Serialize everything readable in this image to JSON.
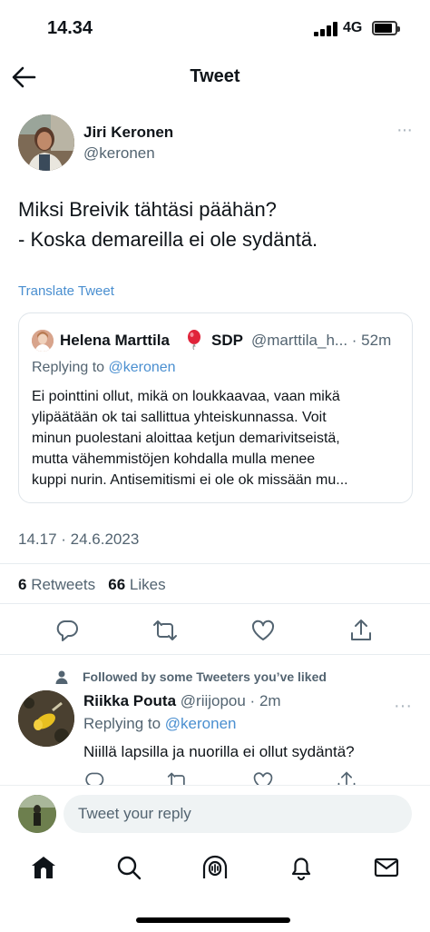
{
  "status": {
    "time": "14.34",
    "network": "4G",
    "battery_level": 0.85
  },
  "nav": {
    "title": "Tweet",
    "back_icon": "arrow-left-icon"
  },
  "tweet": {
    "author_name": "Jiri Keronen",
    "author_handle": "@keronen",
    "more": "···",
    "text_lines": [
      "Miksi Breivik tähtäsi päähän?",
      "- Koska demareilla ei ole sydäntä."
    ],
    "translate": "Translate Tweet",
    "timestamp": "14.17 · 24.6.2023",
    "retweets_count": "6",
    "retweets_label": "Retweets",
    "likes_count": "66",
    "likes_label": "Likes"
  },
  "quote": {
    "name": "Helena Marttila",
    "badge_icon": "balloon-icon",
    "party": "SDP",
    "handle_time": "@marttila_h... · 52m",
    "replying_prefix": "Replying to ",
    "replying_mention": "@keronen",
    "body_lines": [
      "Ei pointtini ollut, mikä on loukkaavaa, vaan mikä",
      "ylipäätään ok tai sallittua yhteiskunnassa. Voit",
      "minun puolestani aloittaa ketjun demarivitseistä,",
      "mutta vähemmistöjen kohdalla mulla menee",
      "kuppi nurin. Antisemitismi ei ole ok missään mu..."
    ]
  },
  "actions": [
    "reply-icon",
    "retweet-icon",
    "like-icon",
    "share-icon"
  ],
  "reply": {
    "social_context": "Followed by some Tweeters you’ve liked",
    "name": "Riikka Pouta",
    "meta": " @riijopou · 2m",
    "replying_prefix": "Replying to ",
    "replying_mention": "@keronen",
    "text": "Niillä lapsilla ja nuorilla ei ollut sydäntä?",
    "more": "···"
  },
  "composer": {
    "placeholder": "Tweet your reply"
  },
  "tabbar": [
    "home-icon",
    "search-icon",
    "spaces-icon",
    "notifications-icon",
    "messages-icon"
  ],
  "colors": {
    "link": "#4a8fd0",
    "secondary": "#536471",
    "text": "#0f1419"
  }
}
